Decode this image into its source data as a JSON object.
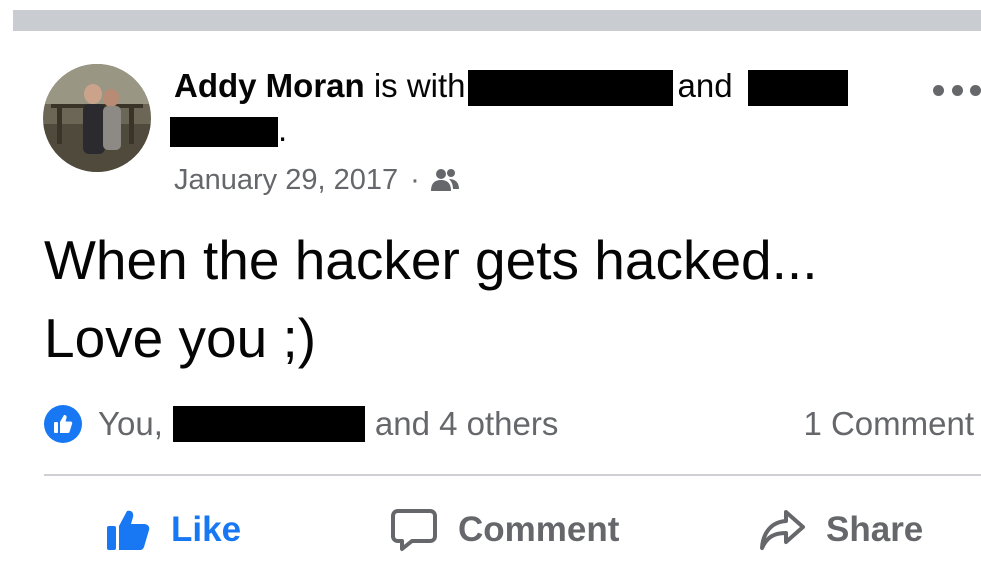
{
  "post": {
    "author": "Addy Moran",
    "with_text": "is with",
    "and_text": "and",
    "period": ".",
    "date": "January 29, 2017",
    "separator": "·",
    "audience_icon": "friends-icon",
    "text_line1": "When the hacker gets hacked...",
    "text_line2": "Love you ;)"
  },
  "reactions": {
    "icon": "like-badge-icon",
    "prefix": "You,",
    "suffix": "and 4 others",
    "comments_count": "1 Comment"
  },
  "actions": {
    "like_label": "Like",
    "comment_label": "Comment",
    "share_label": "Share"
  },
  "colors": {
    "accent": "#1877f2",
    "secondary_text": "#65676b",
    "divider": "#ced0d4",
    "top_bar": "#c9ccd1"
  }
}
